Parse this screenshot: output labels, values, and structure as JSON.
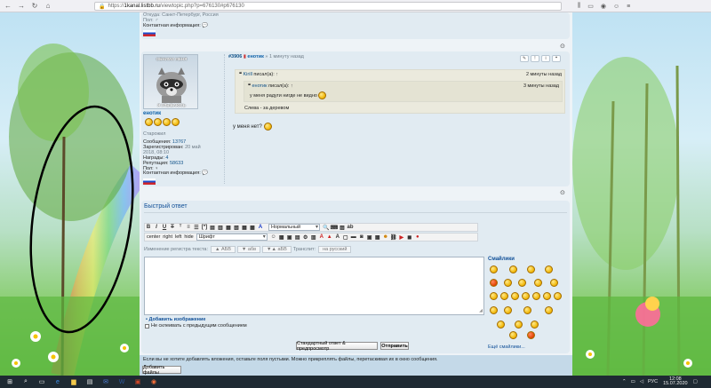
{
  "browser": {
    "url_host": "1kanal.listbb.ru",
    "url_path": "/viewtopic.php?p=676130#p676130",
    "url_prefix": "https://"
  },
  "post_prev": {
    "city_line": "Откуда: Санкт-Петербург, Россия",
    "sex_line": "Пол: ♂",
    "contact_label": "Контактная информация:"
  },
  "post": {
    "avatar_caption_top": "ОБНИМИ МЕНЯ",
    "avatar_caption_bottom": "Я УЛЫБАЮСЬ",
    "username": "енотик",
    "rank": "Старожил",
    "messages_label": "Сообщения:",
    "messages_value": "13767",
    "registered_label": "Зарегистрирован:",
    "registered_value": "20 май 2018, 08:10",
    "awards_label": "Награды:",
    "awards_value": "4",
    "reputation_label": "Репутация:",
    "reputation_value": "58633",
    "sex_label": "Пол:",
    "sex_value": "♀",
    "contact_label": "Контактная информация:",
    "post_number": "#3906",
    "post_author": "енотик",
    "post_time": "» 1 минуту назад",
    "outer_quote_author": "Kirill",
    "outer_quote_wrote": "писал(а):",
    "outer_quote_time": "2 минуты назад",
    "inner_quote_author": "енотик",
    "inner_quote_wrote": "писал(а):",
    "inner_quote_time": "3 минуты назад",
    "inner_quote_text": "у меня радуги нигде не видно",
    "outer_quote_text": "Слева - за деревом",
    "body_text": "у меня нет?"
  },
  "quick_reply": {
    "title": "Быстрый ответ",
    "font_size_value": "Нормальный",
    "font_value": "Шрифт",
    "align_labels": [
      "center",
      "right",
      "left",
      "hide"
    ],
    "case_label": "Изменение регистра текста:",
    "case_buttons": [
      "▲ АБВ",
      "▼ абв",
      "▼▲ аБВ"
    ],
    "translit_label": "Транслит:",
    "to_russian_label": "на русский",
    "smilies_title": "Смайлики",
    "more_smilies": "Ещё смайлики...",
    "add_image": "Добавить изображение",
    "no_merge_label": "Не склеивать с предыдущим сообщением",
    "btn_advanced": "Стандартный ответ & предпросмотр",
    "btn_send": "Отправить"
  },
  "attachments": {
    "hint": "Если вы не хотите добавлять вложения, оставьте поля пустыми. Можно прикреплять файлы, перетаскивая их в окно сообщения.",
    "add_files": "Добавить файлы"
  },
  "taskbar": {
    "lang": "РУС",
    "time": "12:08",
    "date": "15.07.2020"
  },
  "colors": {
    "link_blue": "#105289",
    "username_blue": "#0a5fa8",
    "quote_bg": "#ebeadd",
    "panel_bg": "#e1ebf2"
  },
  "icons": [
    "back-arrow-icon",
    "forward-arrow-icon",
    "reload-icon",
    "home-icon",
    "lock-icon",
    "menu-icon"
  ]
}
